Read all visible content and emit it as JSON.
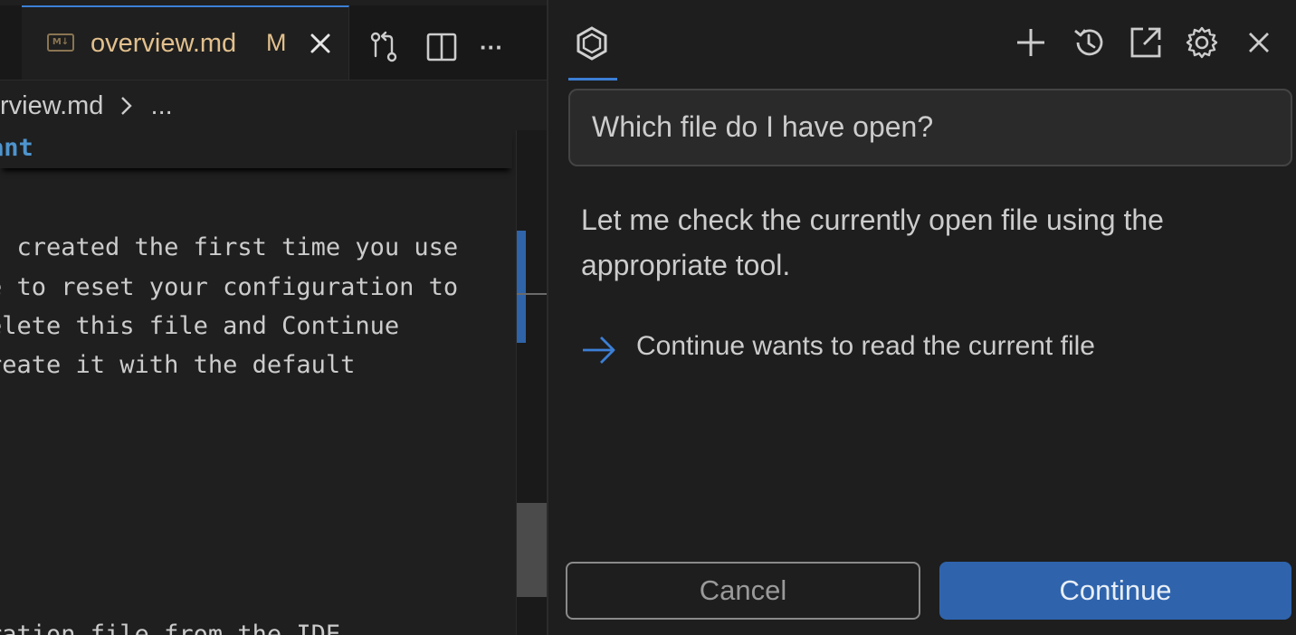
{
  "editor": {
    "tab": {
      "icon": "markdown-icon",
      "icon_text": "M↓",
      "filename": "overview.md",
      "modified_badge": "M",
      "accent": "#e2c08d"
    },
    "toolbar": {
      "icons": [
        "compare-changes-icon",
        "split-editor-icon",
        "more-actions-icon"
      ],
      "more_label": "···"
    },
    "breadcrumb": {
      "file": "rview.md",
      "separator": "chevron-right-icon",
      "ellipsis": "..."
    },
    "sticky_heading": "ant",
    "code_lines": [
      "s created the first time you use",
      "e to reset your configuration to",
      "elete this file and Continue",
      "reate it with the default",
      "ration file from the IDE"
    ]
  },
  "panel": {
    "header": {
      "logo": "continue-logo-icon",
      "icons": [
        "plus-icon",
        "history-icon",
        "open-in-new-window-icon",
        "gear-icon",
        "close-icon"
      ]
    },
    "user_message": "Which file do I have open?",
    "assistant_message": "Let me check the currently open file using the appropriate tool.",
    "tool_call": {
      "icon": "arrow-right-icon",
      "text": "Continue wants to read the current file"
    },
    "actions": {
      "cancel_label": "Cancel",
      "continue_label": "Continue"
    },
    "colors": {
      "primary": "#2f64ad",
      "accent": "#3c7fd6"
    }
  }
}
